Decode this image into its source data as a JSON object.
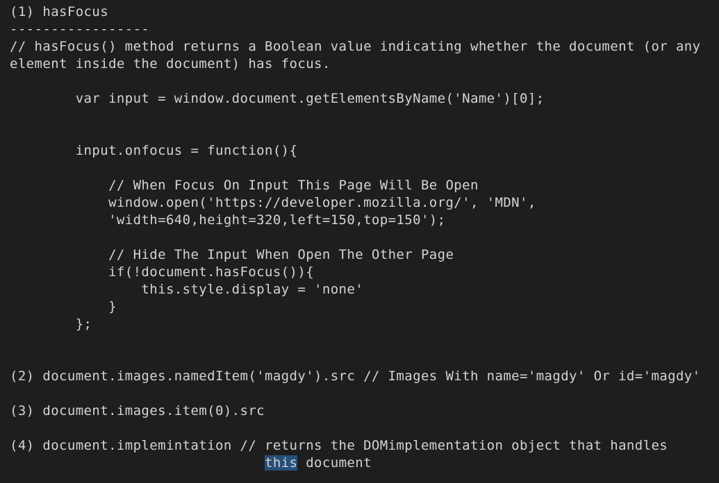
{
  "editor": {
    "lines": [
      "(1) hasFocus",
      "-----------------",
      "// hasFocus() method returns a Boolean value indicating whether the document (or any",
      "element inside the document) has focus.",
      "",
      "        var input = window.document.getElementsByName('Name')[0];",
      "",
      "",
      "        input.onfocus = function(){",
      "",
      "            // When Focus On Input This Page Will Be Open",
      "            window.open('https://developer.mozilla.org/', 'MDN',",
      "            'width=640,height=320,left=150,top=150');",
      "",
      "            // Hide The Input When Open The Other Page",
      "            if(!document.hasFocus()){",
      "                this.style.display = 'none'",
      "            }",
      "        };",
      "",
      "",
      "(2) document.images.namedItem('magdy').src // Images With name='magdy' Or id='magdy'",
      "",
      "(3) document.images.item(0).src",
      "",
      "(4) document.implemintation // returns the DOMimplementation object that handles",
      {
        "indent": "                               ",
        "selected": "this",
        "rest": " document"
      }
    ]
  }
}
